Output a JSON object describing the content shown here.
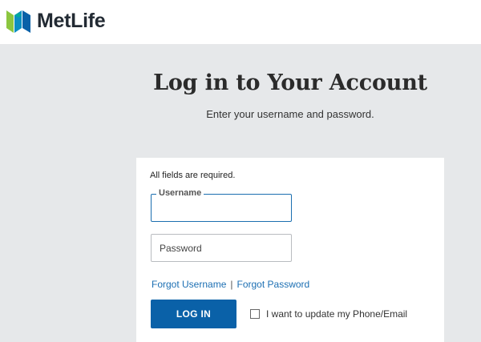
{
  "brand": {
    "name": "MetLife",
    "logo_icon": "metlife-logo-icon",
    "colors": {
      "green": "#8cc63f",
      "blue": "#0a61a8",
      "teal": "#00a8a8"
    }
  },
  "page": {
    "title": "Log in to Your Account",
    "subtitle": "Enter your username and password."
  },
  "form": {
    "required_note": "All fields are required.",
    "username_label": "Username",
    "username_value": "",
    "password_placeholder": "Password",
    "forgot_username": "Forgot Username",
    "separator": "|",
    "forgot_password": "Forgot Password",
    "login_button": "LOG IN",
    "update_checkbox_label": "I want to update my Phone/Email",
    "update_checkbox_checked": false
  }
}
